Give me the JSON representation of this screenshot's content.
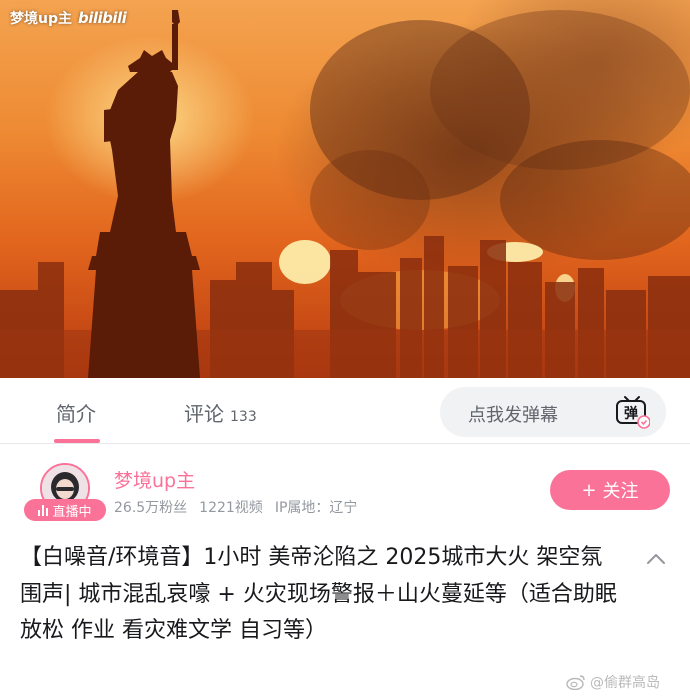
{
  "watermark": {
    "uploader": "梦境up主",
    "platform": "bilibili"
  },
  "tabs": [
    {
      "label": "简介",
      "active": true
    },
    {
      "label": "评论",
      "count": "133",
      "active": false
    }
  ],
  "danmaku": {
    "placeholder": "点我发弹幕",
    "icon": "danmaku-toggle-icon",
    "icon_glyph": "弹"
  },
  "uploader": {
    "name": "梦境up主",
    "live_badge": "直播中",
    "fans": "26.5万粉丝",
    "videos": "1221视频",
    "ip": "IP属地：辽宁",
    "follow_label": "关注",
    "follow_icon": "+"
  },
  "video_title": "【白噪音/环境音】1小时 美帝沦陷之 2025城市大火 架空氛围声| 城市混乱哀嚎 + 火灾现场警报＋山火蔓延等（适合助眠 放松 作业 看灾难文学 自习等）",
  "expand_icon": "chevron-up-icon",
  "footer_watermark": "@偷群高岛",
  "colors": {
    "accent": "#fb7299",
    "text": "#18191c",
    "secondary": "#9499a0",
    "fire_orange": "#e1641d"
  }
}
